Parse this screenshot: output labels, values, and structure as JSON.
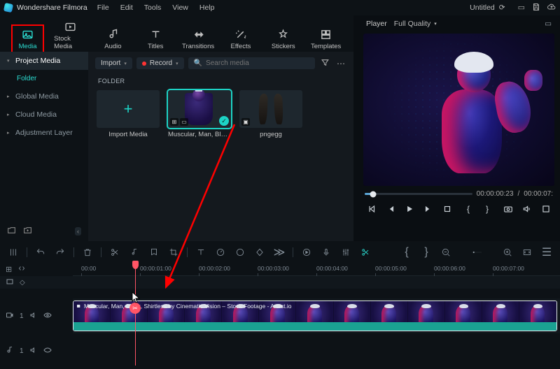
{
  "app": {
    "name": "Wondershare Filmora",
    "document": "Untitled"
  },
  "menu": [
    "File",
    "Edit",
    "Tools",
    "View",
    "Help"
  ],
  "ribbon": [
    {
      "id": "media",
      "label": "Media",
      "active": true
    },
    {
      "id": "stock-media",
      "label": "Stock Media"
    },
    {
      "id": "audio",
      "label": "Audio"
    },
    {
      "id": "titles",
      "label": "Titles"
    },
    {
      "id": "transitions",
      "label": "Transitions"
    },
    {
      "id": "effects",
      "label": "Effects"
    },
    {
      "id": "stickers",
      "label": "Stickers"
    },
    {
      "id": "templates",
      "label": "Templates"
    }
  ],
  "sidebar": {
    "items": [
      {
        "label": "Project Media",
        "active": true
      },
      {
        "label": "Folder",
        "indent": true
      },
      {
        "label": "Global Media"
      },
      {
        "label": "Cloud Media"
      },
      {
        "label": "Adjustment Layer"
      }
    ]
  },
  "mediaBar": {
    "import": "Import",
    "record": "Record",
    "searchPlaceholder": "Search media"
  },
  "folderLabel": "FOLDER",
  "thumbs": {
    "import": "Import Media",
    "clip1": "Muscular, Man, Black,...",
    "clip2": "pngegg"
  },
  "player": {
    "label": "Player",
    "quality": "Full Quality",
    "current": "00:00:00:23",
    "total": "00:00:07:"
  },
  "timeline": {
    "ticks": [
      "00:00",
      "00:00:01:00",
      "00:00:02:00",
      "00:00:03:00",
      "00:00:04:00",
      "00:00:05:00",
      "00:00:06:00",
      "00:00:07:00"
    ],
    "clipTitle": "Muscular, Man, Black, Shirtless by Cinematic Vision – Stock Footage - Artlist.io",
    "videoTrack": "1",
    "audioTrack": "1"
  }
}
